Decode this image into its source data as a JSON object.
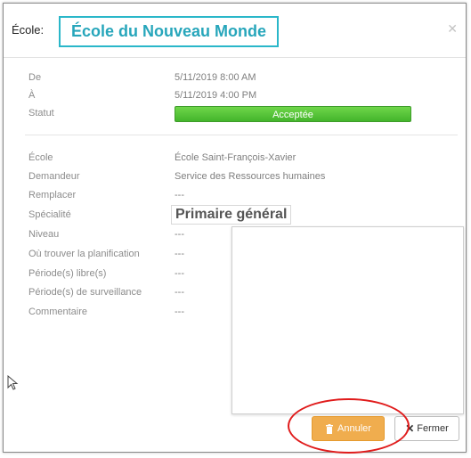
{
  "header": {
    "prefix": "École:",
    "title": "École du Nouveau Monde",
    "close_icon": "close-icon"
  },
  "colors": {
    "title_accent": "#27a6bb",
    "status_green": "#4cbf30",
    "cancel_orange": "#f0ad4e",
    "highlight_red": "#e01b1b"
  },
  "details": {
    "de_label": "De",
    "de_value": "5/11/2019 8:00 AM",
    "a_label": "À",
    "a_value": "5/11/2019 4:00 PM",
    "statut_label": "Statut",
    "statut_value": "Acceptée",
    "ecole_label": "École",
    "ecole_value": "École Saint-François-Xavier",
    "demandeur_label": "Demandeur",
    "demandeur_value": "Service des Ressources humaines",
    "remplacer_label": "Remplacer",
    "remplacer_value": "---",
    "specialite_label": "Spécialité",
    "specialite_value": "Primaire général",
    "niveau_label": "Niveau",
    "niveau_value": "---",
    "planification_label": "Où trouver la planification",
    "planification_value": "---",
    "periodes_libres_label": "Période(s) libre(s)",
    "periodes_libres_value": "---",
    "periodes_surveillance_label": "Période(s) de surveillance",
    "periodes_surveillance_value": "---",
    "commentaire_label": "Commentaire",
    "commentaire_value": "---"
  },
  "footer": {
    "cancel_label": "Annuler",
    "cancel_icon": "trash-icon",
    "close_label": "Fermer",
    "close_icon": "close-x-icon"
  }
}
